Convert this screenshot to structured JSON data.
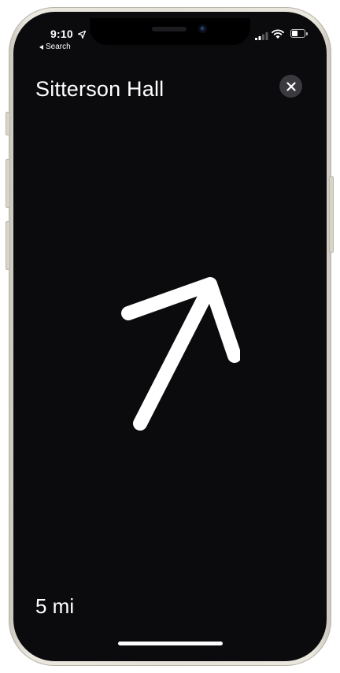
{
  "status_bar": {
    "time": "9:10",
    "back_label": "Search",
    "battery_level": 0.45
  },
  "header": {
    "title": "Sitterson Hall"
  },
  "navigation": {
    "distance": "5 mi"
  },
  "icons": {
    "location": "location-arrow-icon",
    "signal": "cellular-signal-icon",
    "wifi": "wifi-icon",
    "battery": "battery-icon",
    "close": "close-icon",
    "direction": "direction-arrow-icon"
  },
  "colors": {
    "screen_background": "#0b0a0c",
    "foreground": "#ffffff",
    "close_button": "#3a3a3e"
  }
}
